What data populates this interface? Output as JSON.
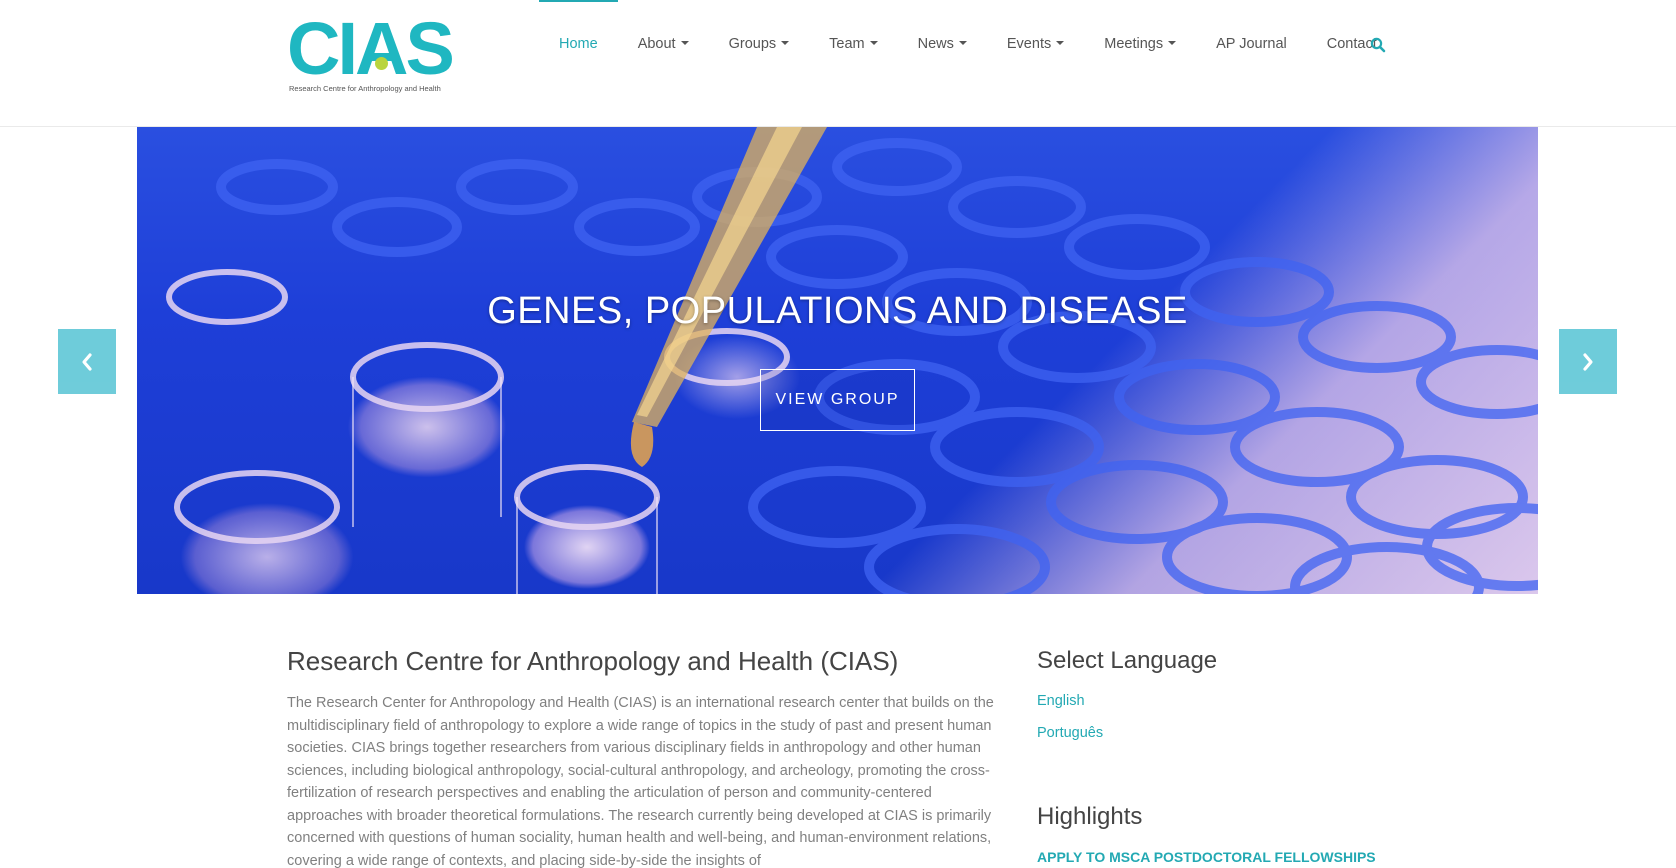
{
  "brand": {
    "name": "CIAS",
    "tagline": "Research Centre for Anthropology and Health",
    "colors": {
      "accent": "#23a9b3",
      "logo_teal": "#1fb7c1",
      "logo_dot": "#b9d43d",
      "arrow_bg": "#5fc7d6"
    }
  },
  "nav": {
    "items": [
      {
        "label": "Home",
        "active": true,
        "dropdown": false
      },
      {
        "label": "About",
        "active": false,
        "dropdown": true
      },
      {
        "label": "Groups",
        "active": false,
        "dropdown": true
      },
      {
        "label": "Team",
        "active": false,
        "dropdown": true
      },
      {
        "label": "News",
        "active": false,
        "dropdown": true
      },
      {
        "label": "Events",
        "active": false,
        "dropdown": true
      },
      {
        "label": "Meetings",
        "active": false,
        "dropdown": true
      },
      {
        "label": "AP Journal",
        "active": false,
        "dropdown": false
      },
      {
        "label": "Contact",
        "active": false,
        "dropdown": false
      }
    ],
    "search_icon": "search-icon"
  },
  "slider": {
    "title": "GENES, POPULATIONS AND DISEASE",
    "button_label": "VIEW GROUP",
    "prev_icon": "chevron-left-icon",
    "next_icon": "chevron-right-icon"
  },
  "main": {
    "title": "Research Centre for Anthropology and Health (CIAS)",
    "body": "The Research Center for Anthropology and Health (CIAS) is an international research center that builds on the multidisciplinary field of anthropology to explore a wide range of topics in the study of past and present human societies. CIAS brings together researchers from various disciplinary fields in anthropology and other human sciences, including biological anthropology, social-cultural anthropology, and archeology, promoting the cross-fertilization of research perspectives and enabling the articulation of person and community-centered approaches with broader theoretical formulations. The research currently being developed at CIAS is primarily concerned with questions of human sociality, human health and well-being, and human-environment relations, covering a wide range of contexts, and placing side-by-side the insights of"
  },
  "sidebar": {
    "language_title": "Select Language",
    "languages": [
      "English",
      "Português"
    ],
    "highlights_title": "Highlights",
    "highlight_link": "APPLY TO MSCA POSTDOCTORAL FELLOWSHIPS"
  }
}
